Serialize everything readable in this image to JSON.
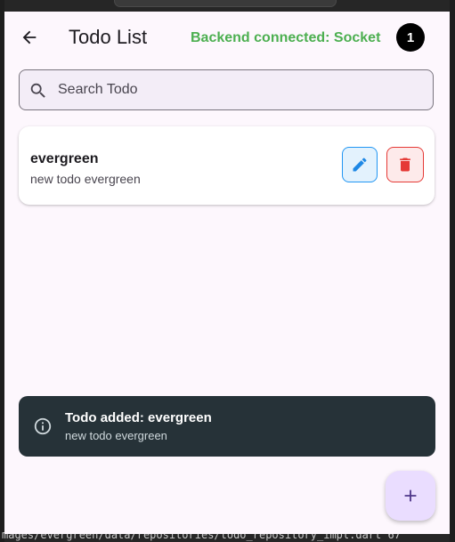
{
  "background": {
    "code_line": "mages/evergreen/data/repositories/todo_repository_impl.dart 67"
  },
  "appbar": {
    "back_icon": "arrow-back-icon",
    "title": "Todo List",
    "backend_status": "Backend connected: Socket",
    "backend_status_color": "#4caf50",
    "todo_count": "1"
  },
  "search": {
    "icon": "search-icon",
    "placeholder": "Search Todo",
    "value": ""
  },
  "todos": [
    {
      "title": "evergreen",
      "description": "new todo evergreen",
      "edit_icon": "pencil-icon",
      "delete_icon": "trash-icon"
    }
  ],
  "snackbar": {
    "icon": "info-icon",
    "title": "Todo added: evergreen",
    "description": "new todo evergreen"
  },
  "fab": {
    "icon": "plus-icon"
  },
  "colors": {
    "app_background": "#fdf7fd",
    "edit_accent": "#2196f3",
    "delete_accent": "#e53935",
    "snackbar_background": "#263238",
    "fab_background": "#eaddff"
  }
}
